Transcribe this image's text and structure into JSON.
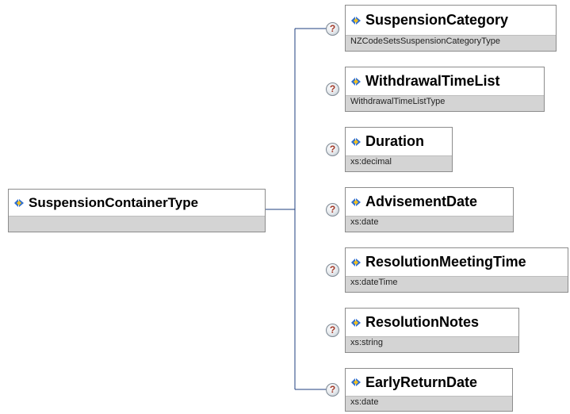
{
  "root": {
    "name": "SuspensionContainerType",
    "type": ""
  },
  "elements": [
    {
      "name": "SuspensionCategory",
      "type": "NZCodeSetsSuspensionCategoryType"
    },
    {
      "name": "WithdrawalTimeList",
      "type": "WithdrawalTimeListType"
    },
    {
      "name": "Duration",
      "type": "xs:decimal"
    },
    {
      "name": "AdvisementDate",
      "type": "xs:date"
    },
    {
      "name": "ResolutionMeetingTime",
      "type": "xs:dateTime"
    },
    {
      "name": "ResolutionNotes",
      "type": "xs:string"
    },
    {
      "name": "EarlyReturnDate",
      "type": "xs:date"
    }
  ],
  "optional_marker": "?",
  "colors": {
    "connector": "#1f3f7f",
    "box_border": "#8c8c8c",
    "type_band": "#d4d4d4",
    "icon_fill": "#2f6fcf",
    "icon_accent": "#f0c020",
    "qmark_text": "#a23a2a"
  }
}
